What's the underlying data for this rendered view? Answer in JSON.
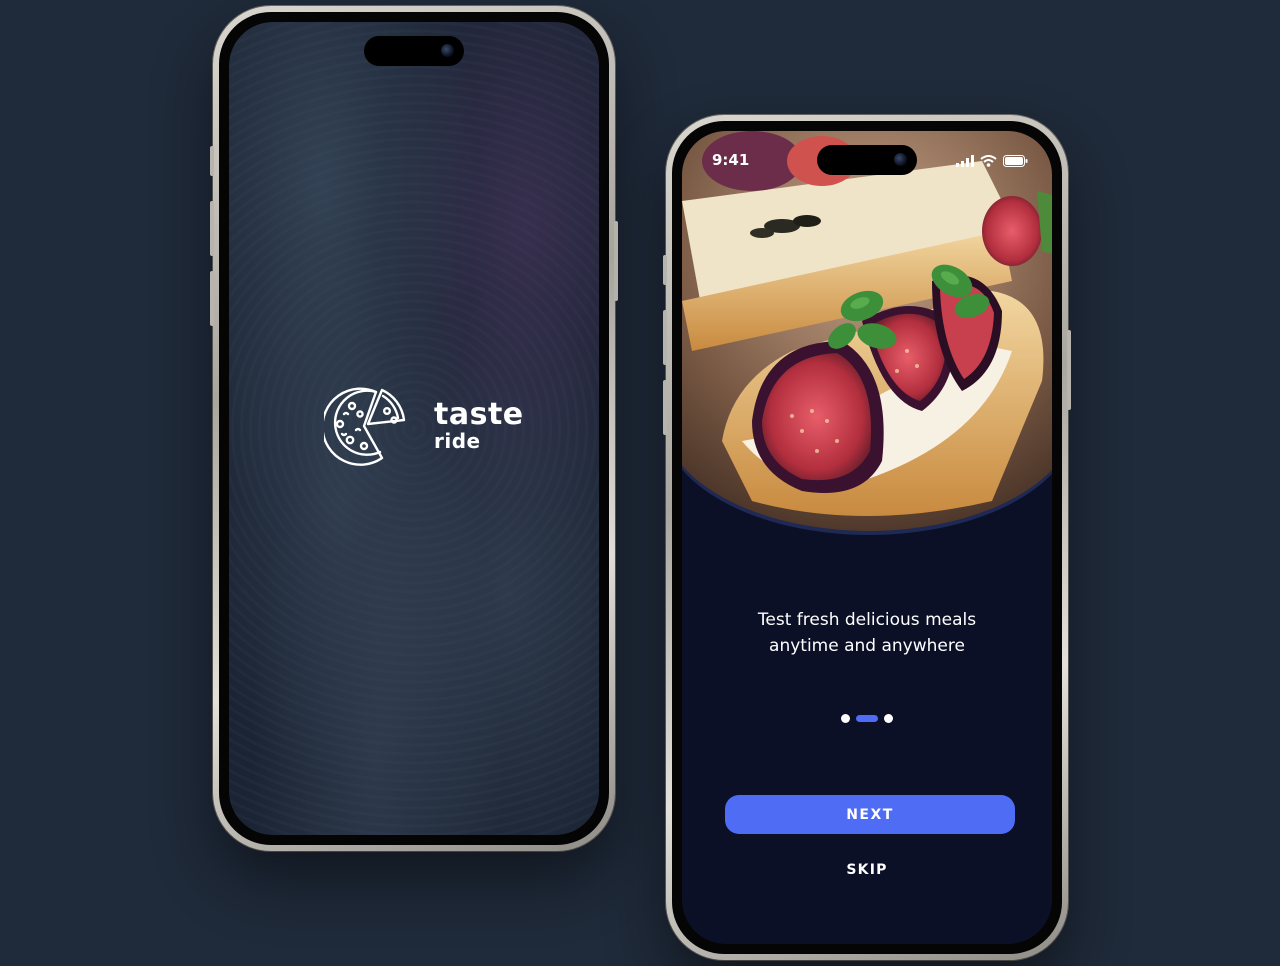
{
  "splash": {
    "brand_top": "taste",
    "brand_bottom": "ride",
    "logo_icon": "pizza-slice-icon"
  },
  "onboarding": {
    "status_time": "9:41",
    "status_icons": [
      "signal-icon",
      "wifi-icon",
      "battery-icon"
    ],
    "hero_image": "fig-bruschetta-photo",
    "tagline_line1": "Test fresh delicious meals",
    "tagline_line2": "anytime and anywhere",
    "pager": {
      "pages": 3,
      "active_index": 1
    },
    "next_label": "NEXT",
    "skip_label": "SKIP"
  },
  "colors": {
    "background": "#1f2a3a",
    "onboarding_bg": "#0b1026",
    "accent": "#4f6cf5"
  }
}
